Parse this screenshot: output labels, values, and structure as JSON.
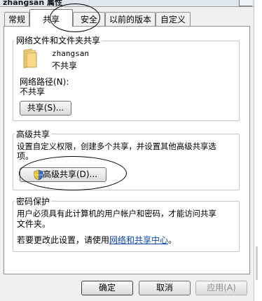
{
  "window": {
    "title": "zhangsan 属性"
  },
  "tabs": [
    {
      "label": "常规"
    },
    {
      "label": "共享"
    },
    {
      "label": "安全"
    },
    {
      "label": "以前的版本"
    },
    {
      "label": "自定义"
    }
  ],
  "network_share": {
    "group_title": "网络文件和文件夹共享",
    "folder_name": "zhangsan",
    "status": "不共享",
    "path_label": "网络路径(N):",
    "path_value": "不共享",
    "share_button": "共享(S)..."
  },
  "advanced_share": {
    "group_title": "高级共享",
    "description_line1": "设置自定义权限，创建多个共享，并设置其他高级共享选",
    "description_line2": "项。",
    "button": "高级共享(D)..."
  },
  "password": {
    "group_title": "密码保护",
    "line1": "用户必须具有此计算机的用户帐户和密码，才能访问共享",
    "line2": "文件夹。",
    "line3_prefix": "若要更改此设置，请使用",
    "link": "网络和共享中心",
    "line3_suffix": "。"
  },
  "footer": {
    "ok": "确定",
    "cancel": "取消",
    "apply": "应用(A)"
  },
  "colors": {
    "link": "#0645ad",
    "panel": "#ffffff",
    "chrome": "#f0f0f0"
  }
}
